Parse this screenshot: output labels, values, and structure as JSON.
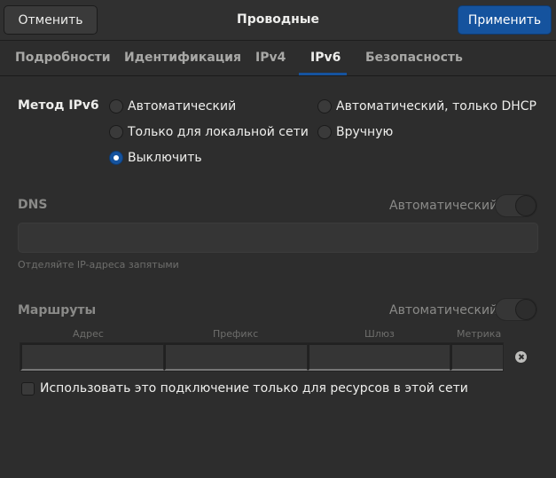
{
  "header": {
    "cancel_label": "Отменить",
    "title": "Проводные",
    "apply_label": "Применить"
  },
  "tabs": [
    {
      "label": "Подробности",
      "active": false
    },
    {
      "label": "Идентификация",
      "active": false
    },
    {
      "label": "IPv4",
      "active": false
    },
    {
      "label": "IPv6",
      "active": true
    },
    {
      "label": "Безопасность",
      "active": false
    }
  ],
  "method": {
    "label": "Метод IPv6",
    "options": [
      {
        "label": "Автоматический",
        "checked": false
      },
      {
        "label": "Автоматический, только DHCP",
        "checked": false
      },
      {
        "label": "Только для локальной сети",
        "checked": false
      },
      {
        "label": "Вручную",
        "checked": false
      },
      {
        "label": "Выключить",
        "checked": true
      }
    ]
  },
  "dns": {
    "label": "DNS",
    "auto_label": "Автоматический",
    "auto_on": false,
    "value": "",
    "hint": "Отделяйте IP-адреса запятыми"
  },
  "routes": {
    "label": "Маршруты",
    "auto_label": "Автоматический",
    "auto_on": false,
    "columns": [
      "Адрес",
      "Префикс",
      "Шлюз",
      "Метрика"
    ]
  },
  "local_only": {
    "label": "Использовать это подключение только для ресурсов в этой сети",
    "checked": false
  },
  "colors": {
    "accent": "#15539e",
    "background": "#2d2d2d"
  },
  "icons": {
    "remove_route": "remove-icon"
  }
}
